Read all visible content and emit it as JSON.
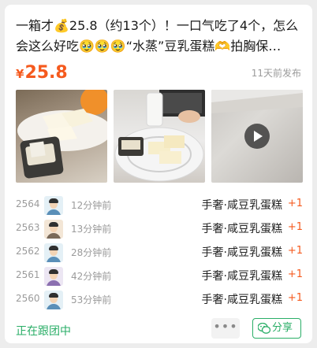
{
  "post": {
    "title": "一箱才💰25.8（约13个）！一口气吃了4个，怎么会这么好吃🥹🥹🥹“水蒸”豆乳蛋糕🫶拍胸保…",
    "currency": "¥",
    "price": "25.8",
    "posted": "11天前发布"
  },
  "photos": [
    {
      "icon": "food-photo"
    },
    {
      "icon": "food-photo"
    },
    {
      "icon": "video-thumbnail"
    }
  ],
  "orders": [
    {
      "num": "2564",
      "time": "12分钟前",
      "item": "手奢·咸豆乳蛋糕",
      "qty": "+1"
    },
    {
      "num": "2563",
      "time": "13分钟前",
      "item": "手奢·咸豆乳蛋糕",
      "qty": "+1"
    },
    {
      "num": "2562",
      "time": "28分钟前",
      "item": "手奢·咸豆乳蛋糕",
      "qty": "+1"
    },
    {
      "num": "2561",
      "time": "42分钟前",
      "item": "手奢·咸豆乳蛋糕",
      "qty": "+1"
    },
    {
      "num": "2560",
      "time": "53分钟前",
      "item": "手奢·咸豆乳蛋糕",
      "qty": "+1"
    }
  ],
  "footer": {
    "status": "正在跟团中",
    "more": "•••",
    "share": "分享"
  },
  "colors": {
    "accent": "#f55a1e",
    "green": "#2aae67"
  }
}
